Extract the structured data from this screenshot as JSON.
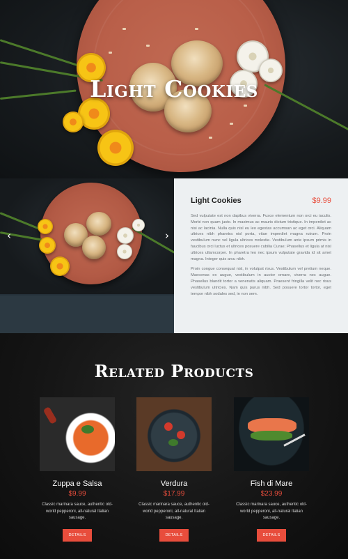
{
  "hero": {
    "title": "Light Cookies"
  },
  "product": {
    "name": "Light Cookies",
    "price": "$9.99",
    "paragraphs": [
      "Sed vulputate est non dapibus viverra. Fusce elementum non orci eu iaculis. Morbi non quam justo. In maximus ac mauris dictum tristique. In imperdiet ac nisi ac lacinia. Nulla quis nisl eu leo egestas accumsan ac eget orci. Aliquam ultrices nibh pharetra nisl porta, vitae imperdiet magna rutrum. Proin vestibulum nunc vel ligula ultrices molestie. Vestibulum ante ipsum primis in faucibus orci luctus et ultrices posuere cubilia Curae; Phasellus et ligula at nisl ultrices ullamcorper. In pharetra leo nec ipsum vulputate gravida id sit amet magna. Integer quis arcu nibh.",
      "Proin congue consequat nisl, in volutpat risus. Vestibulum vel pretium neque. Maecenas ex augue, vestibulum in auctor ornare, viverra nec augue. Phasellus blandit tortor a venenatis aliquam. Praesent fringilla velit nec risus vestibulum ultricies. Nam quis purus nibh. Sed posuere tortor tortor, eget tempor nibh sodales sed, in non sem."
    ],
    "prev_arrow": "‹",
    "next_arrow": "›"
  },
  "related": {
    "title": "Related Products",
    "items": [
      {
        "name": "Zuppa e Salsa",
        "price": "$9.99",
        "desc": "Classic marinara sauce, authentic old-world pepperoni, all-natural Italian sausage.",
        "button": "DETAILS"
      },
      {
        "name": "Verdura",
        "price": "$17.99",
        "desc": "Classic marinara sauce, authentic old-world pepperoni, all-natural Italian sausage.",
        "button": "DETAILS"
      },
      {
        "name": "Fish di Mare",
        "price": "$23.99",
        "desc": "Classic marinara sauce, authentic old-world pepperoni, all-natural Italian sausage.",
        "button": "DETAILS"
      }
    ]
  },
  "colors": {
    "accent": "#e84d3c",
    "info_bg": "#edf0f2",
    "plate": "#b95f49",
    "dark": "#141414"
  }
}
